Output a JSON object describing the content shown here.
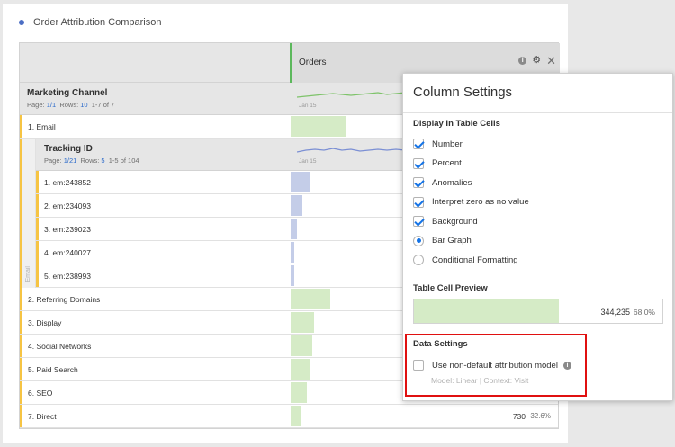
{
  "panel": {
    "title": "Order Attribution Comparison"
  },
  "table": {
    "metric_header": "Orders",
    "dimension": {
      "title": "Marketing Channel",
      "page_label": "Page:",
      "page_value": "1/1",
      "rows_label": "Rows:",
      "rows_value": "10",
      "range": "1-7 of 7",
      "spark_date": "Jan 15"
    },
    "rows": [
      {
        "label": "1. Email",
        "bar": 0.205
      },
      {
        "label": "2. Referring Domains",
        "bar": 0.148
      },
      {
        "label": "3. Display",
        "bar": 0.086
      },
      {
        "label": "4. Social Networks",
        "bar": 0.079
      },
      {
        "label": "5. Paid Search",
        "bar": 0.072
      },
      {
        "label": "6. SEO",
        "bar": 0.062
      },
      {
        "label": "7. Direct",
        "bar": 0.036,
        "value": "730",
        "pct": "32.6%"
      }
    ],
    "nested": {
      "side_label": "Email",
      "title": "Tracking ID",
      "page_label": "Page:",
      "page_value": "1/21",
      "rows_label": "Rows:",
      "rows_value": "5",
      "range": "1-5 of 104",
      "spark_date": "Jan 15",
      "rows": [
        {
          "label": "1. em:243852",
          "bar": 0.072
        },
        {
          "label": "2. em:234093",
          "bar": 0.045
        },
        {
          "label": "3. em:239023",
          "bar": 0.022
        },
        {
          "label": "4. em:240027",
          "bar": 0.014
        },
        {
          "label": "5. em:238993",
          "bar": 0.012
        }
      ]
    }
  },
  "column_settings": {
    "title": "Column Settings",
    "display_heading": "Display In Table Cells",
    "options": [
      {
        "label": "Number",
        "type": "checkbox",
        "checked": true
      },
      {
        "label": "Percent",
        "type": "checkbox",
        "checked": true
      },
      {
        "label": "Anomalies",
        "type": "checkbox",
        "checked": true
      },
      {
        "label": "Interpret zero as no value",
        "type": "checkbox",
        "checked": true
      },
      {
        "label": "Background",
        "type": "checkbox",
        "checked": true
      },
      {
        "label": "Bar Graph",
        "type": "radio",
        "checked": true
      },
      {
        "label": "Conditional Formatting",
        "type": "radio",
        "checked": false
      }
    ],
    "preview_heading": "Table Cell Preview",
    "preview_value": "344,235",
    "preview_pct": "68.0%",
    "preview_bar": 0.58,
    "data_heading": "Data Settings",
    "attribution_label": "Use non-default attribution model",
    "attribution_checked": false,
    "attribution_detail": "Model: Linear  |  Context: Visit"
  },
  "colors": {
    "accent_blue": "#1473e6",
    "bar_green": "#d5ebc6",
    "bar_blue": "#c4cde8",
    "row_accent": "#f6c443",
    "highlight_red": "#e01010"
  }
}
